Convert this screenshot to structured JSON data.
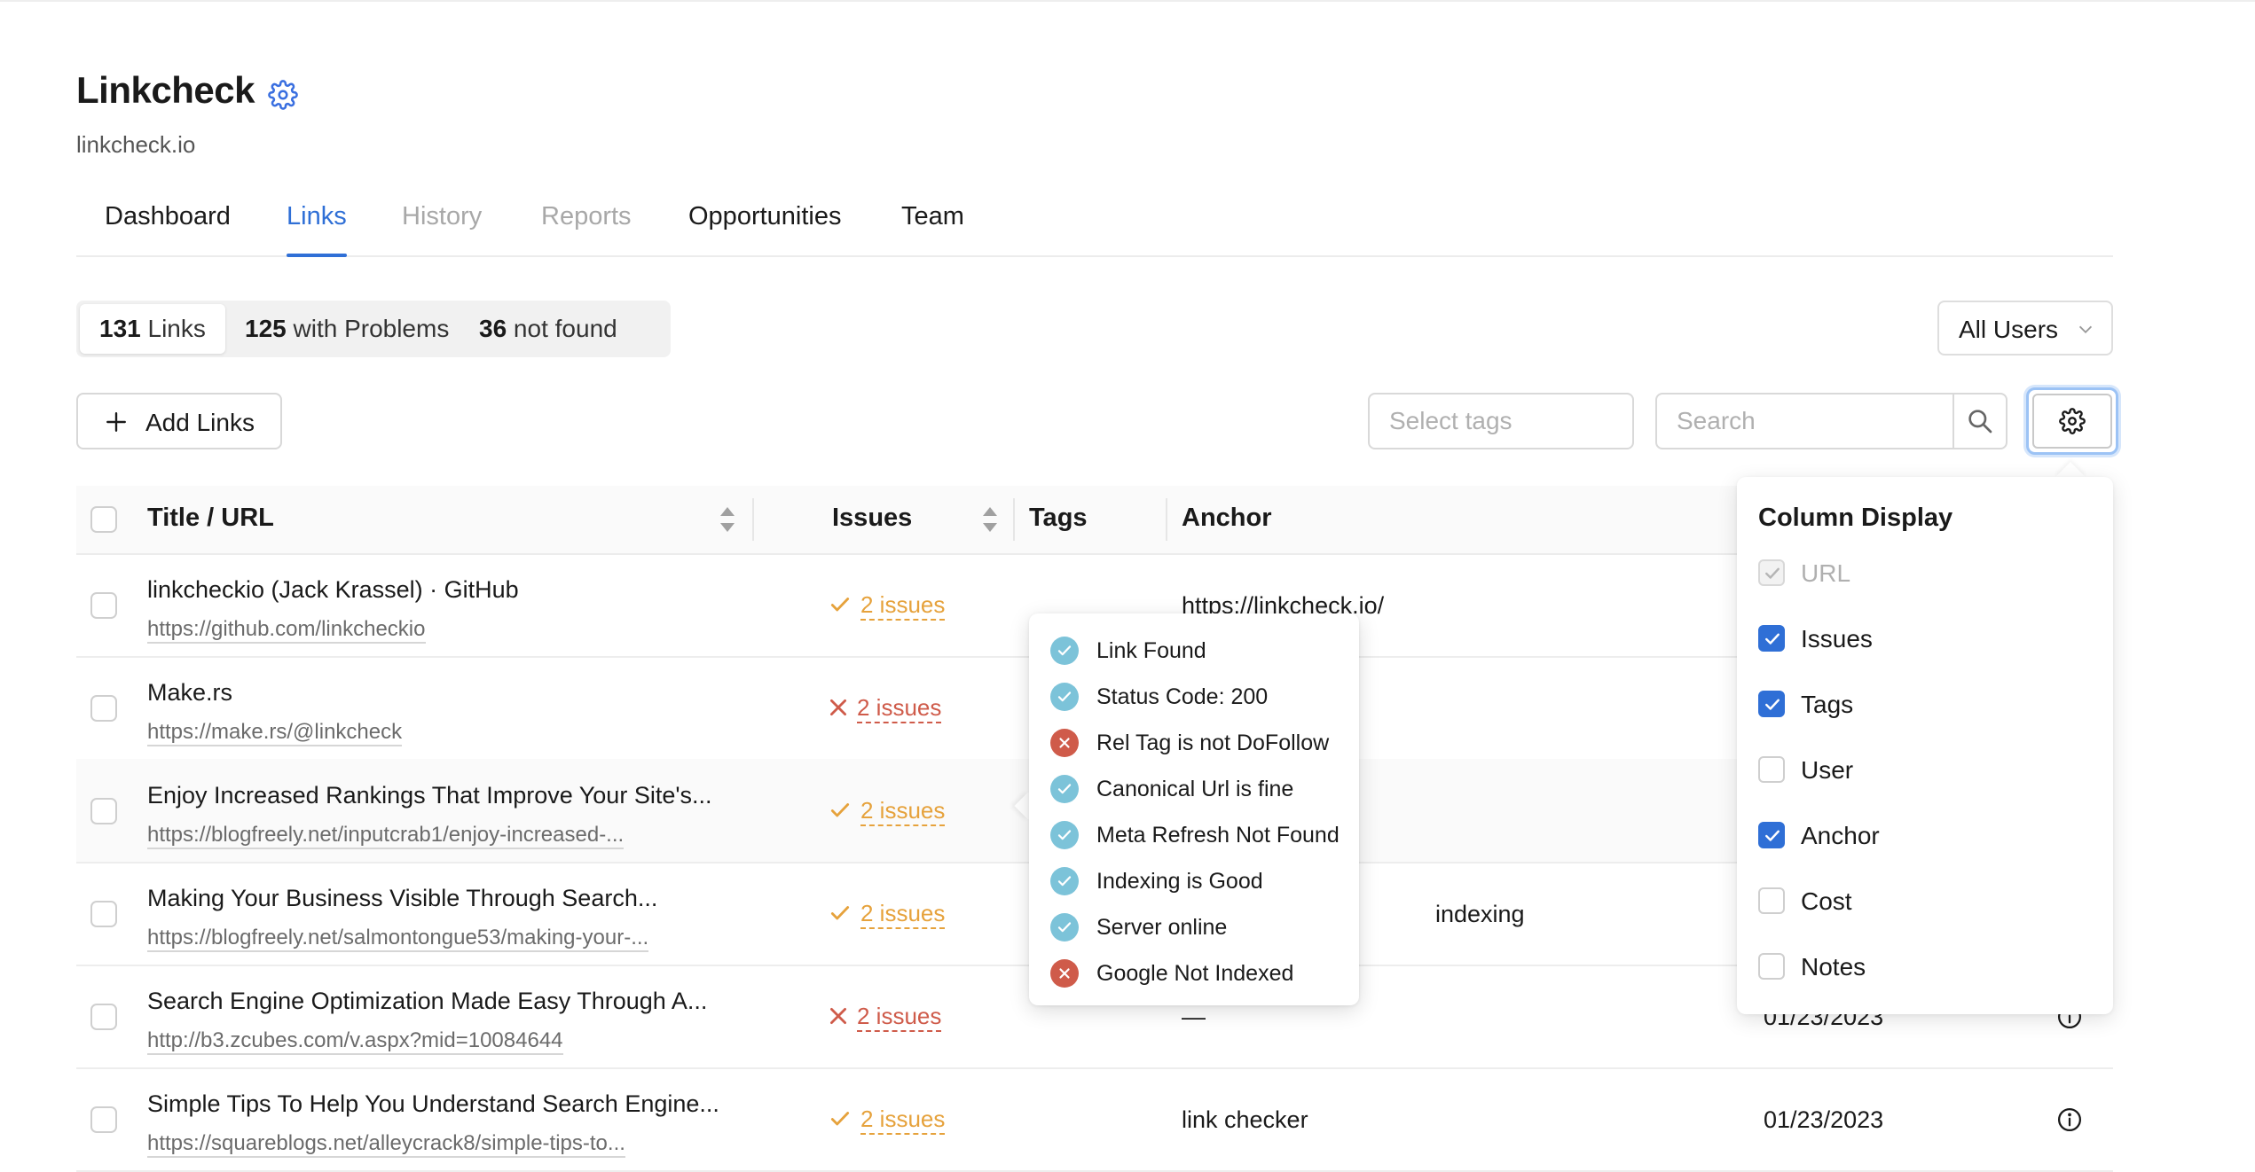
{
  "app": {
    "title": "Linkcheck",
    "domain": "linkcheck.io"
  },
  "tabs": [
    {
      "label": "Dashboard",
      "state": "normal"
    },
    {
      "label": "Links",
      "state": "active"
    },
    {
      "label": "History",
      "state": "disabled"
    },
    {
      "label": "Reports",
      "state": "disabled"
    },
    {
      "label": "Opportunities",
      "state": "normal"
    },
    {
      "label": "Team",
      "state": "normal"
    }
  ],
  "stats": {
    "links_count": "131",
    "links_label": " Links",
    "problems_count": "125",
    "problems_label": " with Problems",
    "notfound_count": "36",
    "notfound_label": " not found"
  },
  "users_filter": {
    "selected": "All Users"
  },
  "toolbar": {
    "add_links_label": "Add Links",
    "tags_placeholder": "Select tags",
    "search_placeholder": "Search"
  },
  "table": {
    "headers": {
      "title_url": "Title / URL",
      "issues": "Issues",
      "tags": "Tags",
      "anchor": "Anchor"
    },
    "rows": [
      {
        "title": "linkcheckio (Jack Krassel) · GitHub",
        "url": "https://github.com/linkcheckio",
        "issues": "2 issues",
        "status": "ok",
        "anchor": "https://linkcheck.io/",
        "date": ""
      },
      {
        "title": "Make.rs",
        "url": "https://make.rs/@linkcheck",
        "issues": "2 issues",
        "status": "bad",
        "anchor": "",
        "date": ""
      },
      {
        "title": "Enjoy Increased Rankings That Improve Your Site's...",
        "url": "https://blogfreely.net/inputcrab1/enjoy-increased-...",
        "issues": "2 issues",
        "status": "ok",
        "anchor": "",
        "date": ""
      },
      {
        "title": "Making Your Business Visible Through Search...",
        "url": "https://blogfreely.net/salmontongue53/making-your-...",
        "issues": "2 issues",
        "status": "ok",
        "anchor": "indexing",
        "date": ""
      },
      {
        "title": "Search Engine Optimization Made Easy Through A...",
        "url": "http://b3.zcubes.com/v.aspx?mid=10084644",
        "issues": "2 issues",
        "status": "bad",
        "anchor": "—",
        "date": "01/23/2023"
      },
      {
        "title": "Simple Tips To Help You Understand Search Engine...",
        "url": "https://squareblogs.net/alleycrack8/simple-tips-to...",
        "issues": "2 issues",
        "status": "ok",
        "anchor": "link checker",
        "date": "01/23/2023"
      }
    ]
  },
  "issues_popover": {
    "items": [
      {
        "label": "Link Found",
        "status": "ok"
      },
      {
        "label": "Status Code: 200",
        "status": "ok"
      },
      {
        "label": "Rel Tag is not DoFollow",
        "status": "bad"
      },
      {
        "label": "Canonical Url is fine",
        "status": "ok"
      },
      {
        "label": "Meta Refresh Not Found",
        "status": "ok"
      },
      {
        "label": "Indexing is Good",
        "status": "ok"
      },
      {
        "label": "Server online",
        "status": "ok"
      },
      {
        "label": "Google Not Indexed",
        "status": "bad"
      }
    ]
  },
  "column_display": {
    "title": "Column Display",
    "items": [
      {
        "label": "URL",
        "checked": true,
        "disabled": true
      },
      {
        "label": "Issues",
        "checked": true,
        "disabled": false
      },
      {
        "label": "Tags",
        "checked": true,
        "disabled": false
      },
      {
        "label": "User",
        "checked": false,
        "disabled": false
      },
      {
        "label": "Anchor",
        "checked": true,
        "disabled": false
      },
      {
        "label": "Cost",
        "checked": false,
        "disabled": false
      },
      {
        "label": "Notes",
        "checked": false,
        "disabled": false
      }
    ]
  },
  "colors": {
    "accent": "#2f6fd6",
    "ok": "#e6a23c",
    "bad": "#cf5b4a",
    "check_ok": "#7cc3d9"
  }
}
